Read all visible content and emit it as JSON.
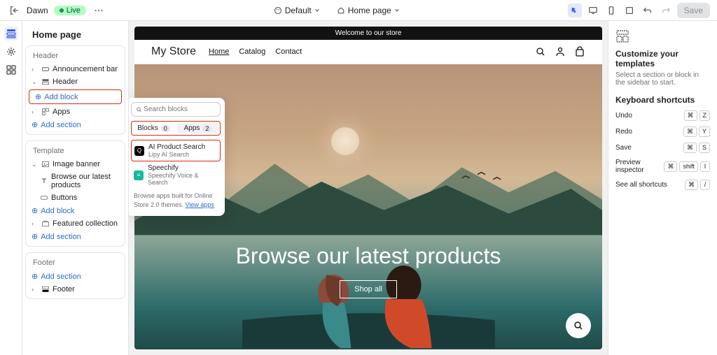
{
  "topbar": {
    "theme_name": "Dawn",
    "live_badge": "Live",
    "style_label": "Default",
    "page_label": "Home page",
    "save_label": "Save"
  },
  "sidebar": {
    "title": "Home page",
    "groups": {
      "header": {
        "label": "Header",
        "items": {
          "announcement": "Announcement bar",
          "header": "Header",
          "add_block": "Add block",
          "apps": "Apps",
          "add_section": "Add section"
        }
      },
      "template": {
        "label": "Template",
        "items": {
          "image_banner": "Image banner",
          "browse_products": "Browse our latest products",
          "buttons": "Buttons",
          "add_block": "Add block",
          "featured": "Featured collection",
          "add_section": "Add section"
        }
      },
      "footer": {
        "label": "Footer",
        "items": {
          "add_section": "Add section",
          "footer": "Footer"
        }
      }
    }
  },
  "popup": {
    "search_placeholder": "Search blocks",
    "tab_blocks": "Blocks",
    "tab_blocks_count": "0",
    "tab_apps": "Apps",
    "tab_apps_count": "2",
    "apps": [
      {
        "name": "AI Product Search",
        "subtitle": "Lipy AI Search",
        "icon_bg": "#000"
      },
      {
        "name": "Speechify",
        "subtitle": "Speechify Voice & Search",
        "icon_bg": "#16b89a"
      }
    ],
    "footer_text": "Browse apps built for Online Store 2.0 themes.",
    "footer_link": "View apps"
  },
  "store": {
    "announcement": "Welcome to our store",
    "name": "My Store",
    "nav": {
      "home": "Home",
      "catalog": "Catalog",
      "contact": "Contact"
    },
    "hero_title": "Browse our latest products",
    "hero_button": "Shop all"
  },
  "rightbar": {
    "customize_title": "Customize your templates",
    "customize_text": "Select a section or block in the sidebar to start.",
    "shortcuts_title": "Keyboard shortcuts",
    "shortcuts": [
      {
        "label": "Undo",
        "keys": [
          "⌘",
          "Z"
        ]
      },
      {
        "label": "Redo",
        "keys": [
          "⌘",
          "Y"
        ]
      },
      {
        "label": "Save",
        "keys": [
          "⌘",
          "S"
        ]
      },
      {
        "label": "Preview inspector",
        "keys": [
          "⌘",
          "shift",
          "I"
        ]
      },
      {
        "label": "See all shortcuts",
        "keys": [
          "⌘",
          "/"
        ]
      }
    ]
  },
  "icons": {
    "search": "🔍"
  }
}
